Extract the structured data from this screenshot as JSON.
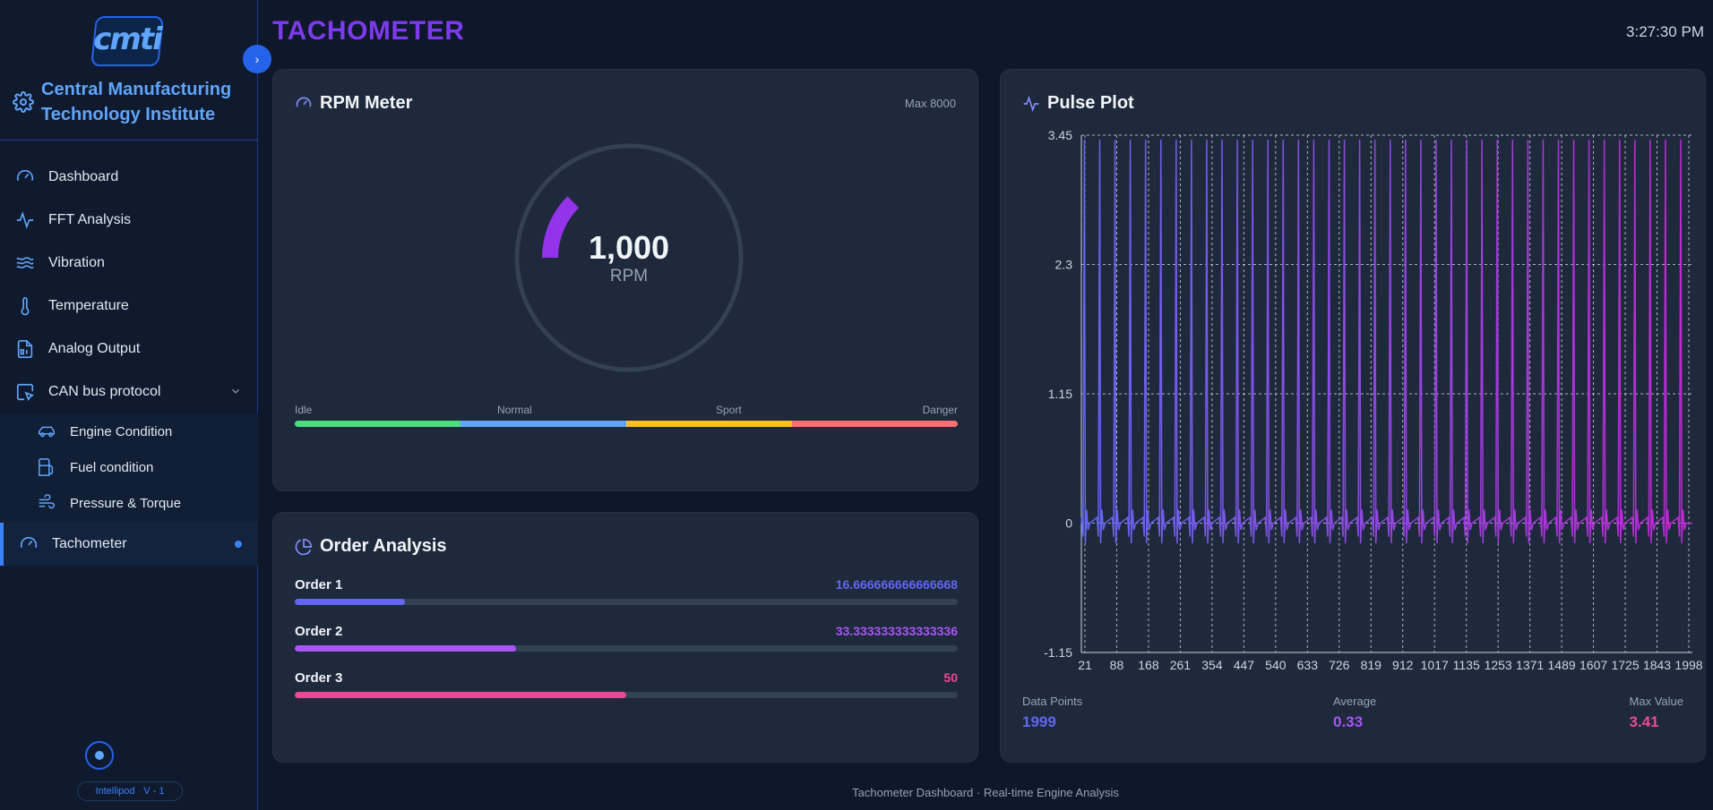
{
  "sidebar": {
    "logo_text": "cmti",
    "org_name": "Central Manufacturing Technology Institute",
    "items": [
      {
        "label": "Dashboard",
        "icon": "gauge-icon"
      },
      {
        "label": "FFT Analysis",
        "icon": "activity-icon"
      },
      {
        "label": "Vibration",
        "icon": "waves-icon"
      },
      {
        "label": "Temperature",
        "icon": "thermometer-icon"
      },
      {
        "label": "Analog Output",
        "icon": "binary-file-icon"
      },
      {
        "label": "CAN bus protocol",
        "icon": "cursor-box-icon"
      }
    ],
    "sub_items": [
      {
        "label": "Engine Condition",
        "icon": "car-icon"
      },
      {
        "label": "Fuel condition",
        "icon": "fuel-icon"
      },
      {
        "label": "Pressure & Torque",
        "icon": "wind-icon"
      }
    ],
    "active_item": {
      "label": "Tachometer",
      "icon": "gauge-icon"
    },
    "version_name": "Intellipod",
    "version_sep": "·",
    "version_num": "V - 1"
  },
  "header": {
    "title": "TACHOMETER",
    "time": "3:27:30 PM"
  },
  "rpm": {
    "title": "RPM Meter",
    "max_label": "Max 8000",
    "value_text": "1,000",
    "unit": "RPM",
    "value": 1000,
    "max": 8000,
    "zones": [
      {
        "label": "Idle",
        "color": "#4ade80"
      },
      {
        "label": "Normal",
        "color": "#60a5fa"
      },
      {
        "label": "Sport",
        "color": "#fbbf24"
      },
      {
        "label": "Danger",
        "color": "#f87171"
      }
    ],
    "arc_color": "#9333ea"
  },
  "orders": {
    "title": "Order Analysis",
    "items": [
      {
        "name": "Order 1",
        "value_text": "16.666666666666668",
        "fraction": 0.1667,
        "color": "#6366f1"
      },
      {
        "name": "Order 2",
        "value_text": "33.333333333333336",
        "fraction": 0.3333,
        "color": "#a855f7"
      },
      {
        "name": "Order 3",
        "value_text": "50",
        "fraction": 0.5,
        "color": "#ec4899"
      }
    ]
  },
  "pulse": {
    "title": "Pulse Plot",
    "stats": [
      {
        "label": "Data Points",
        "value": "1999",
        "color": "#6366f1"
      },
      {
        "label": "Average",
        "value": "0.33",
        "color": "#a855f7"
      },
      {
        "label": "Max Value",
        "value": "3.41",
        "color": "#ec4899"
      }
    ]
  },
  "chart_data": {
    "type": "line",
    "title": "",
    "xlabel": "",
    "ylabel": "",
    "x_tick_labels": [
      "21",
      "88",
      "168",
      "261",
      "354",
      "447",
      "540",
      "633",
      "726",
      "819",
      "912",
      "1017",
      "1135",
      "1253",
      "1371",
      "1489",
      "1607",
      "1725",
      "1843",
      "1998"
    ],
    "y_tick_labels": [
      "3.45",
      "2.3",
      "1.15",
      "0",
      "-1.15"
    ],
    "ylim": [
      -1.15,
      3.45
    ],
    "xlim": [
      0,
      1998
    ],
    "grid": true,
    "pulse_x": [
      10,
      60,
      110,
      160,
      210,
      260,
      310,
      360,
      410,
      460,
      510,
      560,
      610,
      660,
      710,
      760,
      810,
      860,
      910,
      960,
      1010,
      1060,
      1110,
      1160,
      1210,
      1260,
      1310,
      1360,
      1410,
      1460,
      1510,
      1560,
      1610,
      1660,
      1710,
      1760,
      1810,
      1860,
      1910,
      1960
    ],
    "pulse_peak": 3.41,
    "baseline": 0,
    "line_color_start": "#6366f1",
    "line_color_end": "#c026d3"
  },
  "footer": "Tachometer Dashboard · Real-time Engine Analysis"
}
